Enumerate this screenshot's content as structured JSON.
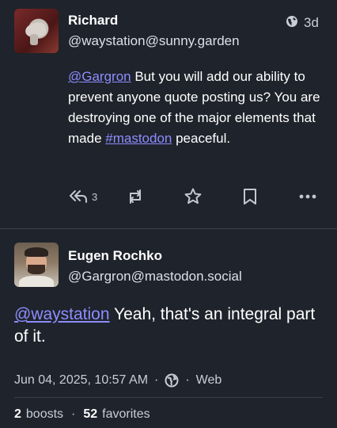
{
  "post1": {
    "display_name": "Richard",
    "handle": "@waystation@sunny.garden",
    "relative_time": "3d",
    "visibility_icon": "globe-icon",
    "mention": "@Gargron",
    "text_part1": " But you will add our ability to prevent anyone quote posting us? You are destroying one of the major elements that made ",
    "hashtag": "#mastodon",
    "text_part2": " peaceful.",
    "actions": {
      "reply_count": "3",
      "reply_icon": "reply-all-icon",
      "boost_icon": "boost-icon",
      "favorite_icon": "star-icon",
      "bookmark_icon": "bookmark-icon",
      "more_icon": "more-horizontal-icon"
    }
  },
  "post2": {
    "display_name": "Eugen Rochko",
    "handle": "@Gargron@mastodon.social",
    "mention": "@waystation",
    "text": " Yeah, that's an integral part of it.",
    "timestamp": "Jun 04, 2025, 10:57 AM",
    "meta_sep1": "·",
    "visibility_icon": "globe-icon",
    "meta_sep2": "·",
    "application": "Web",
    "boosts_count": "2",
    "boosts_label": "boosts",
    "stats_sep": "·",
    "favorites_count": "52",
    "favorites_label": "favorites"
  },
  "colors": {
    "background": "#1f232b",
    "link": "#8c8dff",
    "muted_text": "#c9cdd6"
  }
}
